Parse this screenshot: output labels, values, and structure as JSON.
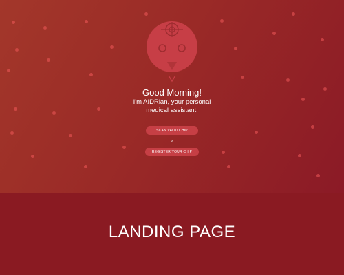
{
  "colors": {
    "background": "#8a1a22",
    "screen_gradient_start": "#a3372a",
    "screen_gradient_end": "#8b1a26",
    "button": "#c63f45",
    "mascot": "#c73e46"
  },
  "mascot": {
    "icon": "robot-head-icon"
  },
  "greeting": "Good Morning!",
  "intro": {
    "line1": "I'm AIDRian, your personal",
    "line2": "medical assistant."
  },
  "actions": {
    "scan_label": "SCAN VALID CHIP",
    "or_label": "or",
    "register_label": "REGISTER YOUR CHIP"
  },
  "caption": "LANDING PAGE"
}
